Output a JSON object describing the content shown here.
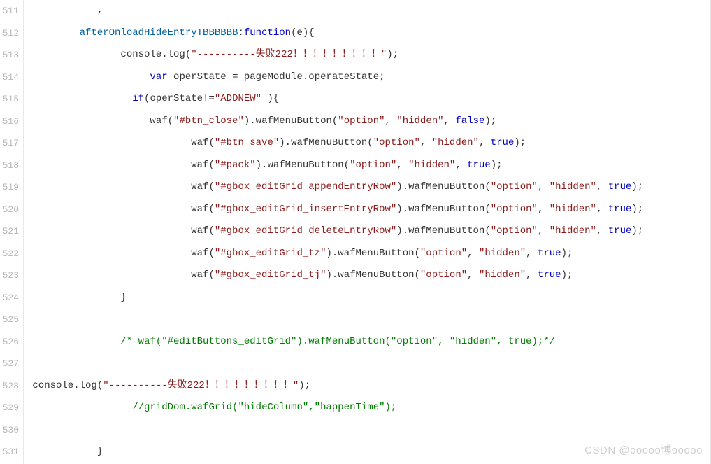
{
  "watermark": "CSDN @ooooo博ooooo",
  "lines": [
    {
      "num": "511",
      "tokens": [
        {
          "t": "            ,",
          "c": ""
        }
      ]
    },
    {
      "num": "512",
      "tokens": [
        {
          "t": "         afterOnloadHideEntryTBBBBBB",
          "c": "prop"
        },
        {
          "t": ":",
          "c": ""
        },
        {
          "t": "function",
          "c": "kw"
        },
        {
          "t": "(e){",
          "c": ""
        }
      ]
    },
    {
      "num": "513",
      "tokens": [
        {
          "t": "                console.log(",
          "c": ""
        },
        {
          "t": "\"----------失败222！！！！！！！！！\"",
          "c": "str"
        },
        {
          "t": ");",
          "c": ""
        }
      ]
    },
    {
      "num": "514",
      "tokens": [
        {
          "t": "                     ",
          "c": ""
        },
        {
          "t": "var",
          "c": "kw"
        },
        {
          "t": " operState = pageModule.operateState;",
          "c": ""
        }
      ]
    },
    {
      "num": "515",
      "tokens": [
        {
          "t": "                  ",
          "c": ""
        },
        {
          "t": "if",
          "c": "kw"
        },
        {
          "t": "(operState!=",
          "c": ""
        },
        {
          "t": "\"ADDNEW\"",
          "c": "str"
        },
        {
          "t": " ){",
          "c": ""
        }
      ]
    },
    {
      "num": "516",
      "tokens": [
        {
          "t": "                     waf(",
          "c": ""
        },
        {
          "t": "\"#btn_close\"",
          "c": "str"
        },
        {
          "t": ").wafMenuButton(",
          "c": ""
        },
        {
          "t": "\"option\"",
          "c": "str"
        },
        {
          "t": ", ",
          "c": ""
        },
        {
          "t": "\"hidden\"",
          "c": "str"
        },
        {
          "t": ", ",
          "c": ""
        },
        {
          "t": "false",
          "c": "bool"
        },
        {
          "t": ");",
          "c": ""
        }
      ]
    },
    {
      "num": "517",
      "tokens": [
        {
          "t": "                            waf(",
          "c": ""
        },
        {
          "t": "\"#btn_save\"",
          "c": "str"
        },
        {
          "t": ").wafMenuButton(",
          "c": ""
        },
        {
          "t": "\"option\"",
          "c": "str"
        },
        {
          "t": ", ",
          "c": ""
        },
        {
          "t": "\"hidden\"",
          "c": "str"
        },
        {
          "t": ", ",
          "c": ""
        },
        {
          "t": "true",
          "c": "bool"
        },
        {
          "t": ");",
          "c": ""
        }
      ]
    },
    {
      "num": "518",
      "tokens": [
        {
          "t": "                            waf(",
          "c": ""
        },
        {
          "t": "\"#pack\"",
          "c": "str"
        },
        {
          "t": ").wafMenuButton(",
          "c": ""
        },
        {
          "t": "\"option\"",
          "c": "str"
        },
        {
          "t": ", ",
          "c": ""
        },
        {
          "t": "\"hidden\"",
          "c": "str"
        },
        {
          "t": ", ",
          "c": ""
        },
        {
          "t": "true",
          "c": "bool"
        },
        {
          "t": ");",
          "c": ""
        }
      ]
    },
    {
      "num": "519",
      "tokens": [
        {
          "t": "                            waf(",
          "c": ""
        },
        {
          "t": "\"#gbox_editGrid_appendEntryRow\"",
          "c": "str"
        },
        {
          "t": ").wafMenuButton(",
          "c": ""
        },
        {
          "t": "\"option\"",
          "c": "str"
        },
        {
          "t": ", ",
          "c": ""
        },
        {
          "t": "\"hidden\"",
          "c": "str"
        },
        {
          "t": ", ",
          "c": ""
        },
        {
          "t": "true",
          "c": "bool"
        },
        {
          "t": ");",
          "c": ""
        }
      ]
    },
    {
      "num": "520",
      "tokens": [
        {
          "t": "                            waf(",
          "c": ""
        },
        {
          "t": "\"#gbox_editGrid_insertEntryRow\"",
          "c": "str"
        },
        {
          "t": ").wafMenuButton(",
          "c": ""
        },
        {
          "t": "\"option\"",
          "c": "str"
        },
        {
          "t": ", ",
          "c": ""
        },
        {
          "t": "\"hidden\"",
          "c": "str"
        },
        {
          "t": ", ",
          "c": ""
        },
        {
          "t": "true",
          "c": "bool"
        },
        {
          "t": ");",
          "c": ""
        }
      ]
    },
    {
      "num": "521",
      "tokens": [
        {
          "t": "                            waf(",
          "c": ""
        },
        {
          "t": "\"#gbox_editGrid_deleteEntryRow\"",
          "c": "str"
        },
        {
          "t": ").wafMenuButton(",
          "c": ""
        },
        {
          "t": "\"option\"",
          "c": "str"
        },
        {
          "t": ", ",
          "c": ""
        },
        {
          "t": "\"hidden\"",
          "c": "str"
        },
        {
          "t": ", ",
          "c": ""
        },
        {
          "t": "true",
          "c": "bool"
        },
        {
          "t": ");",
          "c": ""
        }
      ]
    },
    {
      "num": "522",
      "tokens": [
        {
          "t": "                            waf(",
          "c": ""
        },
        {
          "t": "\"#gbox_editGrid_tz\"",
          "c": "str"
        },
        {
          "t": ").wafMenuButton(",
          "c": ""
        },
        {
          "t": "\"option\"",
          "c": "str"
        },
        {
          "t": ", ",
          "c": ""
        },
        {
          "t": "\"hidden\"",
          "c": "str"
        },
        {
          "t": ", ",
          "c": ""
        },
        {
          "t": "true",
          "c": "bool"
        },
        {
          "t": ");",
          "c": ""
        }
      ]
    },
    {
      "num": "523",
      "tokens": [
        {
          "t": "                            waf(",
          "c": ""
        },
        {
          "t": "\"#gbox_editGrid_tj\"",
          "c": "str"
        },
        {
          "t": ").wafMenuButton(",
          "c": ""
        },
        {
          "t": "\"option\"",
          "c": "str"
        },
        {
          "t": ", ",
          "c": ""
        },
        {
          "t": "\"hidden\"",
          "c": "str"
        },
        {
          "t": ", ",
          "c": ""
        },
        {
          "t": "true",
          "c": "bool"
        },
        {
          "t": ");",
          "c": ""
        }
      ]
    },
    {
      "num": "524",
      "tokens": [
        {
          "t": "                }",
          "c": ""
        }
      ]
    },
    {
      "num": "525",
      "tokens": [
        {
          "t": "",
          "c": ""
        }
      ]
    },
    {
      "num": "526",
      "tokens": [
        {
          "t": "                ",
          "c": ""
        },
        {
          "t": "/* waf(\"#editButtons_editGrid\").wafMenuButton(\"option\", \"hidden\", true);*/",
          "c": "cmt"
        }
      ]
    },
    {
      "num": "527",
      "tokens": [
        {
          "t": "",
          "c": ""
        }
      ]
    },
    {
      "num": "528",
      "tokens": [
        {
          "t": " console.log(",
          "c": ""
        },
        {
          "t": "\"----------失败222！！！！！！！！！\"",
          "c": "str"
        },
        {
          "t": ");",
          "c": ""
        }
      ]
    },
    {
      "num": "529",
      "tokens": [
        {
          "t": "                  ",
          "c": ""
        },
        {
          "t": "//gridDom.wafGrid(\"hideColumn\",\"happenTime\");",
          "c": "cmt"
        }
      ]
    },
    {
      "num": "530",
      "tokens": [
        {
          "t": "",
          "c": ""
        }
      ]
    },
    {
      "num": "531",
      "tokens": [
        {
          "t": "            }",
          "c": ""
        }
      ]
    }
  ]
}
